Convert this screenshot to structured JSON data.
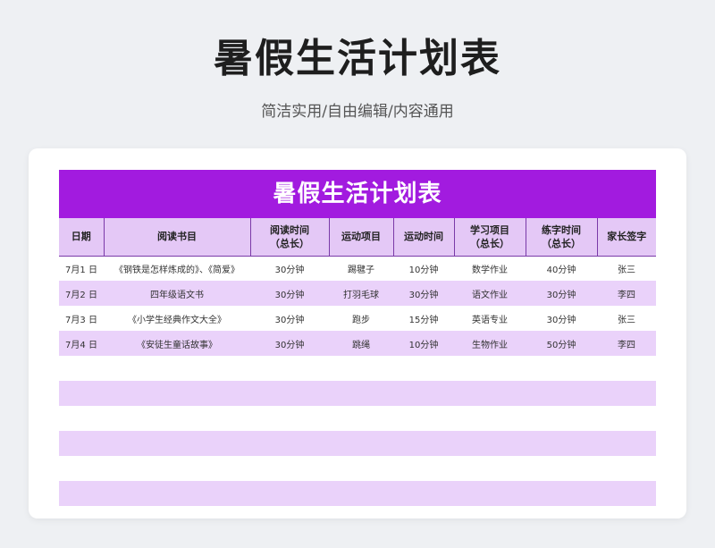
{
  "header": {
    "title": "暑假生活计划表",
    "subtitle": "简洁实用/自由编辑/内容通用"
  },
  "sheet": {
    "title": "暑假生活计划表",
    "columns": [
      "日期",
      "阅读书目",
      "阅读时间\n（总长）",
      "运动项目",
      "运动时间",
      "学习项目\n（总长）",
      "练字时间\n（总长）",
      "家长签字"
    ],
    "rows": [
      [
        "7月1 日",
        "《钢铁是怎样炼成的》、《简爱》",
        "30分钟",
        "踢毽子",
        "10分钟",
        "数学作业",
        "40分钟",
        "张三"
      ],
      [
        "7月2 日",
        "四年级语文书",
        "30分钟",
        "打羽毛球",
        "30分钟",
        "语文作业",
        "30分钟",
        "李四"
      ],
      [
        "7月3 日",
        "《小学生经典作文大全》",
        "30分钟",
        "跑步",
        "15分钟",
        "英语专业",
        "30分钟",
        "张三"
      ],
      [
        "7月4 日",
        "《安徒生童话故事》",
        "30分钟",
        "跳绳",
        "10分钟",
        "生物作业",
        "50分钟",
        "李四"
      ]
    ]
  },
  "colors": {
    "title_bar": "#a21bdf",
    "header_bg": "#e4c8f6",
    "stripe": "#ead2fa"
  }
}
